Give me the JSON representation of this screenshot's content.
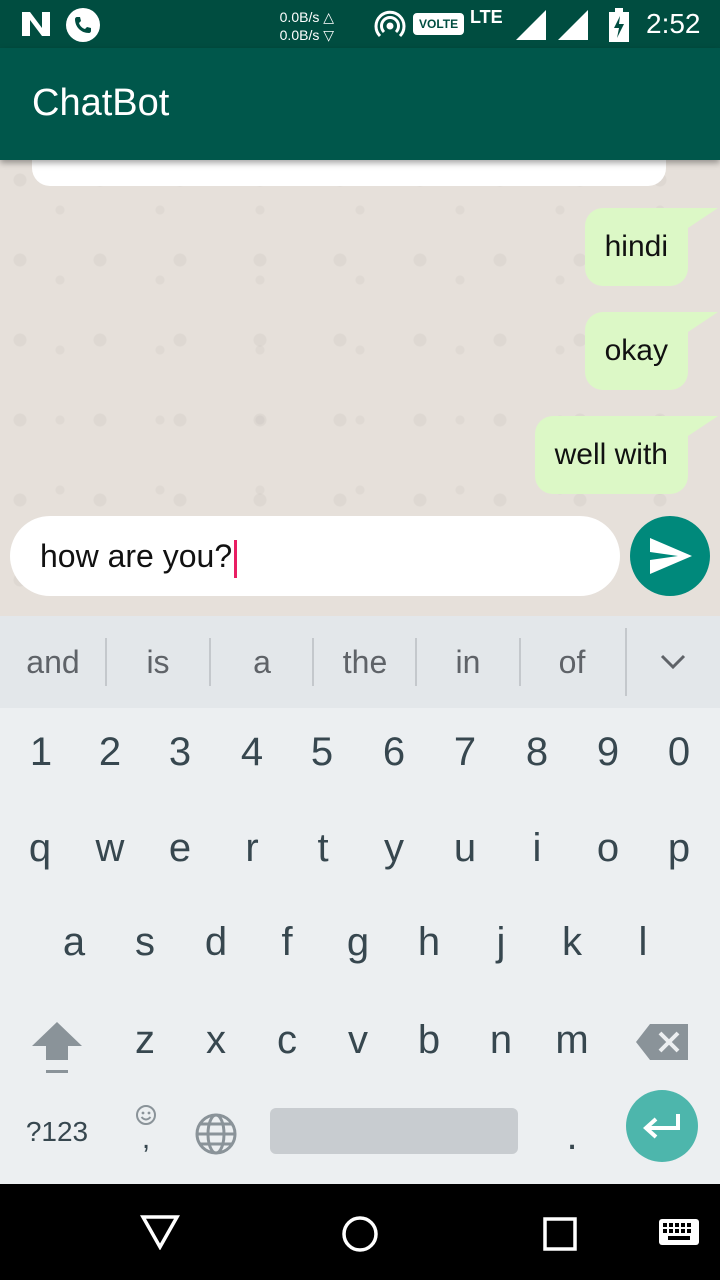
{
  "status_bar": {
    "speed_up": "0.0B/s △",
    "speed_down": "0.0B/s ▽",
    "volte": "VOLTE",
    "network": "LTE",
    "time": "2:52"
  },
  "app_bar": {
    "title": "ChatBot"
  },
  "chat": {
    "messages": [
      {
        "text": "hindi",
        "sender": "user"
      },
      {
        "text": "okay",
        "sender": "user"
      },
      {
        "text": "well with",
        "sender": "user"
      }
    ]
  },
  "input": {
    "value": "how are you?"
  },
  "keyboard": {
    "suggestions": [
      "and",
      "is",
      "a",
      "the",
      "in",
      "of"
    ],
    "number_row": [
      "1",
      "2",
      "3",
      "4",
      "5",
      "6",
      "7",
      "8",
      "9",
      "0"
    ],
    "row1": [
      "q",
      "w",
      "e",
      "r",
      "t",
      "y",
      "u",
      "i",
      "o",
      "p"
    ],
    "row2": [
      "a",
      "s",
      "d",
      "f",
      "g",
      "h",
      "j",
      "k",
      "l"
    ],
    "row3": [
      "z",
      "x",
      "c",
      "v",
      "b",
      "n",
      "m"
    ],
    "symbols_label": "?123",
    "comma": ",",
    "period": "."
  },
  "colors": {
    "status_bar": "#004d40",
    "app_bar": "#00574b",
    "user_bubble": "#dcf8c6",
    "send_button": "#00897b",
    "enter_button": "#4db6ac",
    "caret": "#e91e63"
  }
}
